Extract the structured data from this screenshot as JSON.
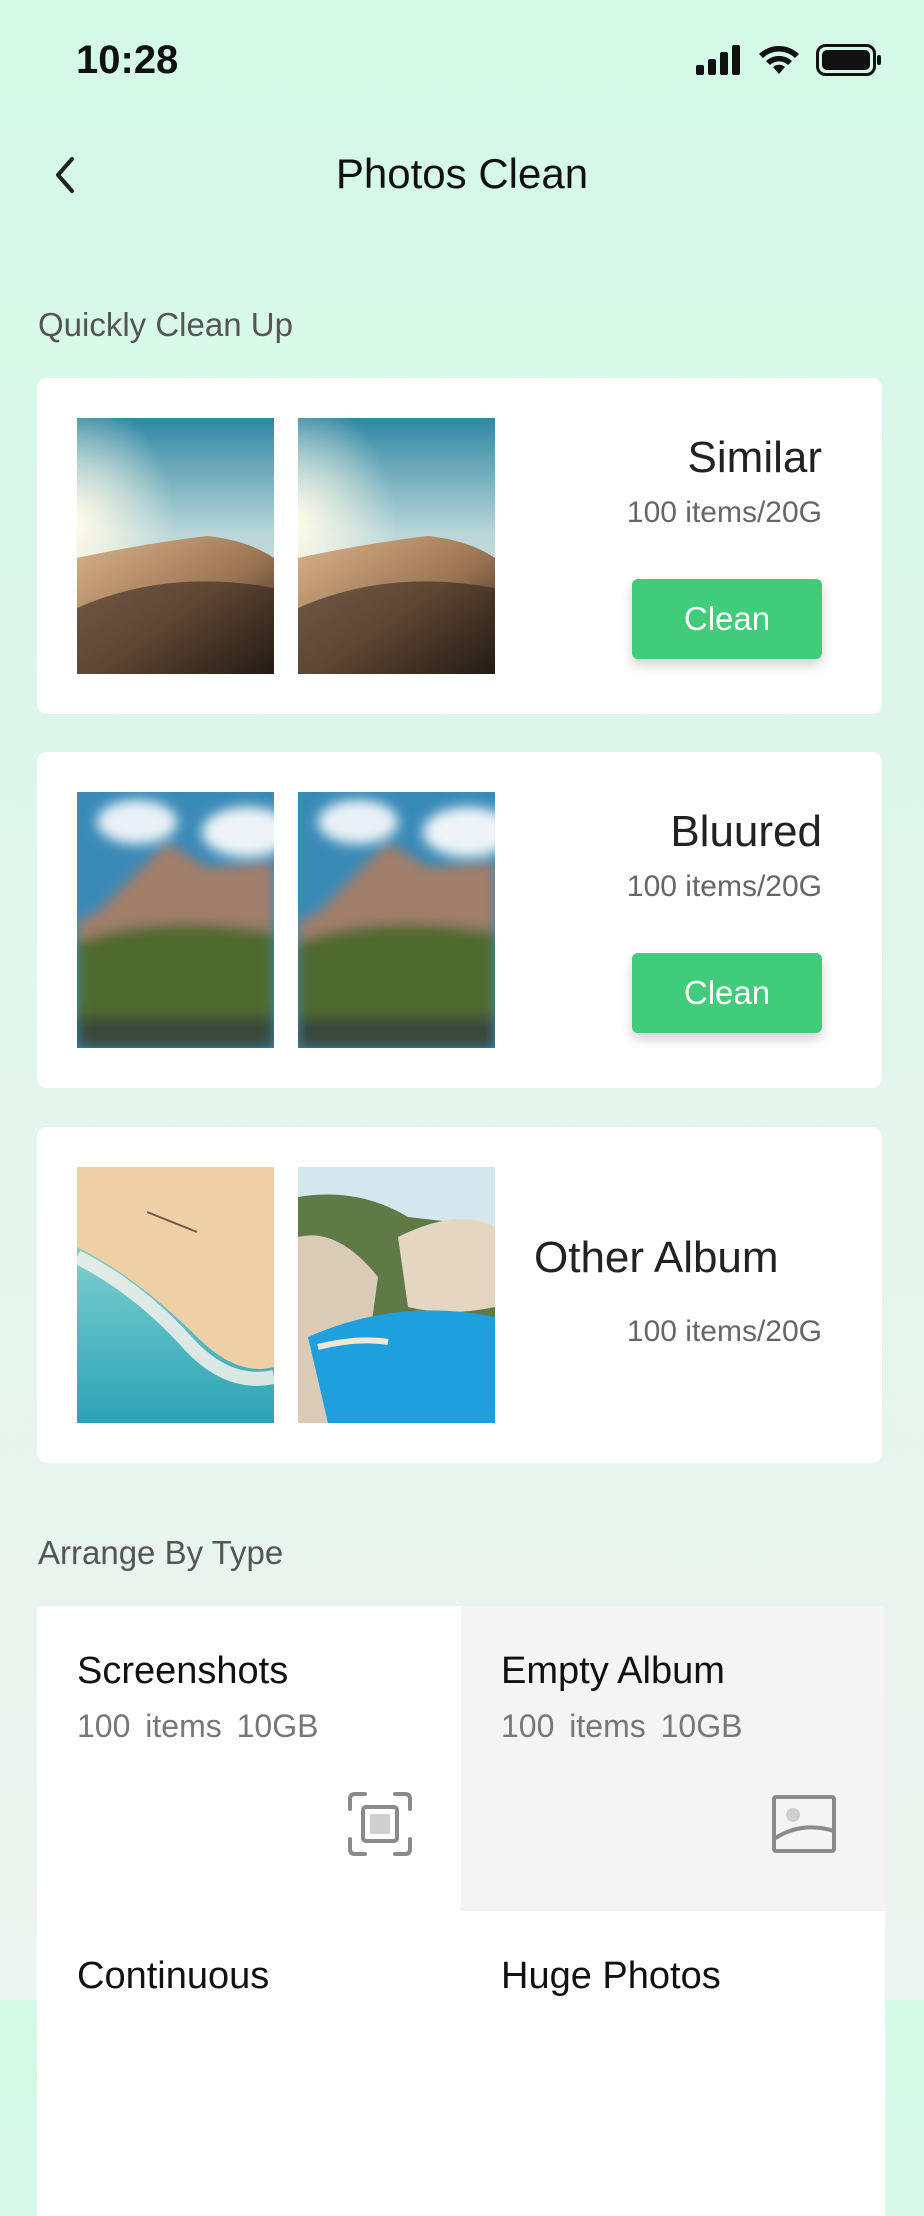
{
  "status_bar": {
    "time": "10:28"
  },
  "header": {
    "title": "Photos Clean"
  },
  "quick_clean": {
    "section_title": "Quickly Clean Up",
    "cards": [
      {
        "title": "Similar",
        "subtitle": "100 items/20G",
        "button": "Clean"
      },
      {
        "title": "Bluured",
        "subtitle": "100 items/20G",
        "button": "Clean"
      },
      {
        "title": "Other Album",
        "subtitle": "100 items/20G"
      }
    ]
  },
  "arrange": {
    "section_title": "Arrange By Type",
    "tiles": [
      {
        "title": "Screenshots",
        "count": "100 items",
        "size": "10GB",
        "icon": "screenshot-icon"
      },
      {
        "title": "Empty Album",
        "count": "100 items",
        "size": "10GB",
        "icon": "image-placeholder-icon"
      },
      {
        "title": "Continuous",
        "count": "",
        "size": ""
      },
      {
        "title": "Huge Photos",
        "count": "",
        "size": ""
      }
    ]
  },
  "colors": {
    "accent": "#40cc7a",
    "background_top": "#d3f9e7"
  }
}
